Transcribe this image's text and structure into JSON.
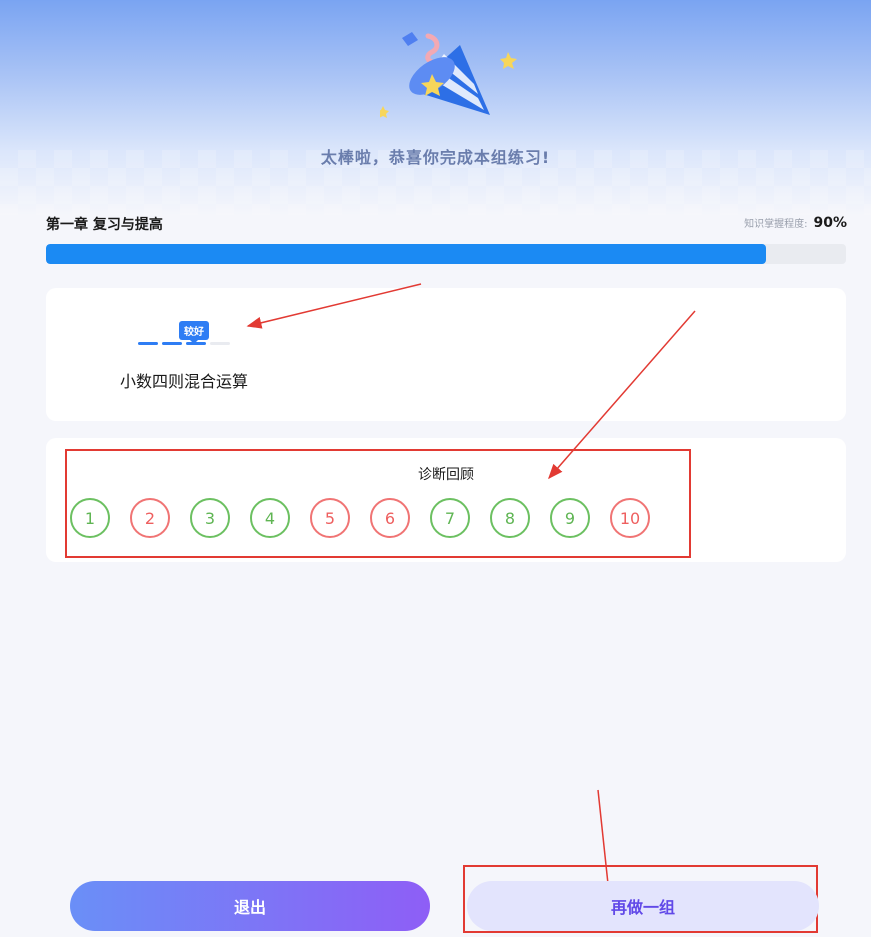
{
  "hero": {
    "title": "太棒啦，恭喜你完成本组练习!"
  },
  "chapter": {
    "title": "第一章 复习与提高",
    "mastery_label": "知识掌握程度:",
    "mastery_value": "90%",
    "mastery_fraction": 0.9
  },
  "knowledge": {
    "level_label": "较好",
    "level_active": 3,
    "level_total": 4,
    "name": "小数四则混合运算"
  },
  "review": {
    "title": "诊断回顾",
    "questions": [
      {
        "num": "1",
        "status": "correct"
      },
      {
        "num": "2",
        "status": "wrong"
      },
      {
        "num": "3",
        "status": "correct"
      },
      {
        "num": "4",
        "status": "correct"
      },
      {
        "num": "5",
        "status": "wrong"
      },
      {
        "num": "6",
        "status": "wrong"
      },
      {
        "num": "7",
        "status": "correct"
      },
      {
        "num": "8",
        "status": "correct"
      },
      {
        "num": "9",
        "status": "correct"
      },
      {
        "num": "10",
        "status": "wrong"
      }
    ]
  },
  "buttons": {
    "exit": "退出",
    "retry": "再做一组"
  },
  "colors": {
    "primary": "#1b8af3",
    "correct": "#6cc061",
    "wrong": "#f07474",
    "annotation": "#e23a33"
  }
}
